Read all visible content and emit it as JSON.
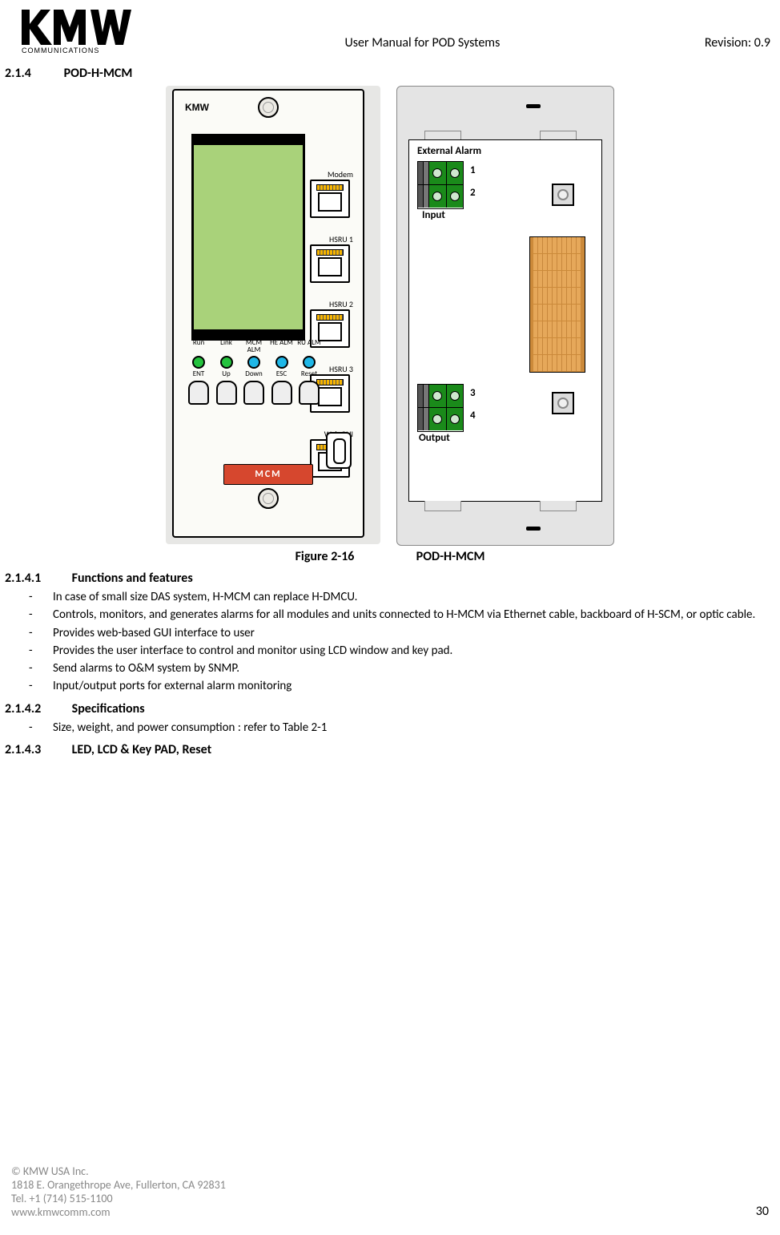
{
  "header": {
    "doc_title": "User Manual for POD Systems",
    "revision": "Revision: 0.9"
  },
  "logo": {
    "brand_top": "KMW",
    "brand_sub": "COMMUNICATIONS"
  },
  "section": {
    "number": "2.1.4",
    "title": "POD-H-MCM"
  },
  "figure": {
    "label": "Figure 2-16",
    "title": "POD-H-MCM"
  },
  "device_left": {
    "brand": "KMW",
    "ports": [
      "Modem",
      "HSRU 1",
      "HSRU 2",
      "HSRU 3",
      "Web GUI"
    ],
    "leds": [
      "Run",
      "Link",
      "MCM\nALM",
      "HE\nALM",
      "RU\nALM"
    ],
    "buttons": [
      "ENT",
      "Up",
      "Down",
      "ESC",
      "Reset"
    ],
    "module_label": "MCM"
  },
  "device_right": {
    "external_alarm": "External Alarm",
    "input_label": "Input",
    "output_label": "Output",
    "pins": {
      "n1": "1",
      "n2": "2",
      "n3": "3",
      "n4": "4"
    }
  },
  "sub1": {
    "number": "2.1.4.1",
    "title": "Functions and features",
    "bullets": [
      "In case of small size DAS system, H-MCM can replace H-DMCU.",
      "Controls, monitors, and generates alarms for all modules and units connected to H-MCM via Ethernet cable, backboard of H-SCM, or optic cable.",
      "Provides web-based GUI interface to user",
      "Provides the user interface to control and monitor using LCD window and key pad.",
      "Send alarms to O&M system by SNMP.",
      "Input/output ports for external alarm monitoring"
    ]
  },
  "sub2": {
    "number": "2.1.4.2",
    "title": "Specifications",
    "bullets": [
      "Size, weight, and power consumption : refer to Table 2-1"
    ]
  },
  "sub3": {
    "number": "2.1.4.3",
    "title": "LED, LCD & Key PAD, Reset"
  },
  "footer": {
    "copyright": "©  KMW USA Inc.",
    "address": "1818 E. Orangethrope Ave, Fullerton, CA 92831",
    "tel": "Tel. +1 (714) 515-1100",
    "web": "www.kmwcomm.com",
    "page": "30"
  }
}
